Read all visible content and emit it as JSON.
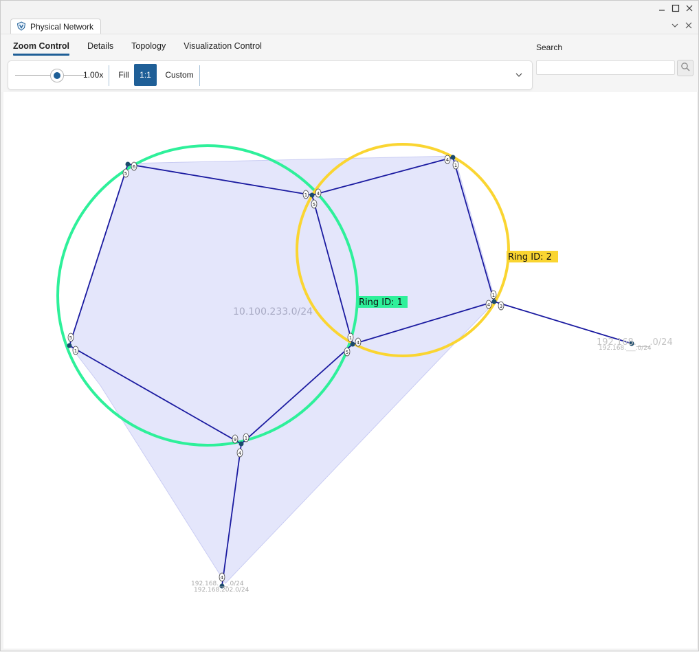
{
  "doc_tab": {
    "title": "Physical Network",
    "icon": "network-app-icon"
  },
  "ribbon": {
    "tabs": [
      {
        "label": "Zoom Control",
        "active": true
      },
      {
        "label": "Details",
        "active": false
      },
      {
        "label": "Topology",
        "active": false
      },
      {
        "label": "Visualization Control",
        "active": false
      }
    ]
  },
  "zoom": {
    "value_text": "1.00x",
    "level": 1.0,
    "fill_label": "Fill",
    "one_to_one_label": "1:1",
    "custom_label": "Custom",
    "active_mode": "1:1"
  },
  "search": {
    "label": "Search",
    "value": "",
    "placeholder": ""
  },
  "topology": {
    "area_label": "10.100.233.0/24",
    "rings": [
      {
        "label": "Ring ID: 1",
        "color": "#2ef09a"
      },
      {
        "label": "Ring ID: 2",
        "color": "#fad531"
      }
    ],
    "subnet_labels": {
      "bottom_a": "192.168.___.0/24",
      "bottom_b": "192.168.202.0/24",
      "right_a": "192.168.___.0/24",
      "right_b": "192.168.___.0/24"
    },
    "colors": {
      "link": "#1a1aa0",
      "hull_fill": "#e4e6fb",
      "node": "#1b4a6b"
    }
  }
}
